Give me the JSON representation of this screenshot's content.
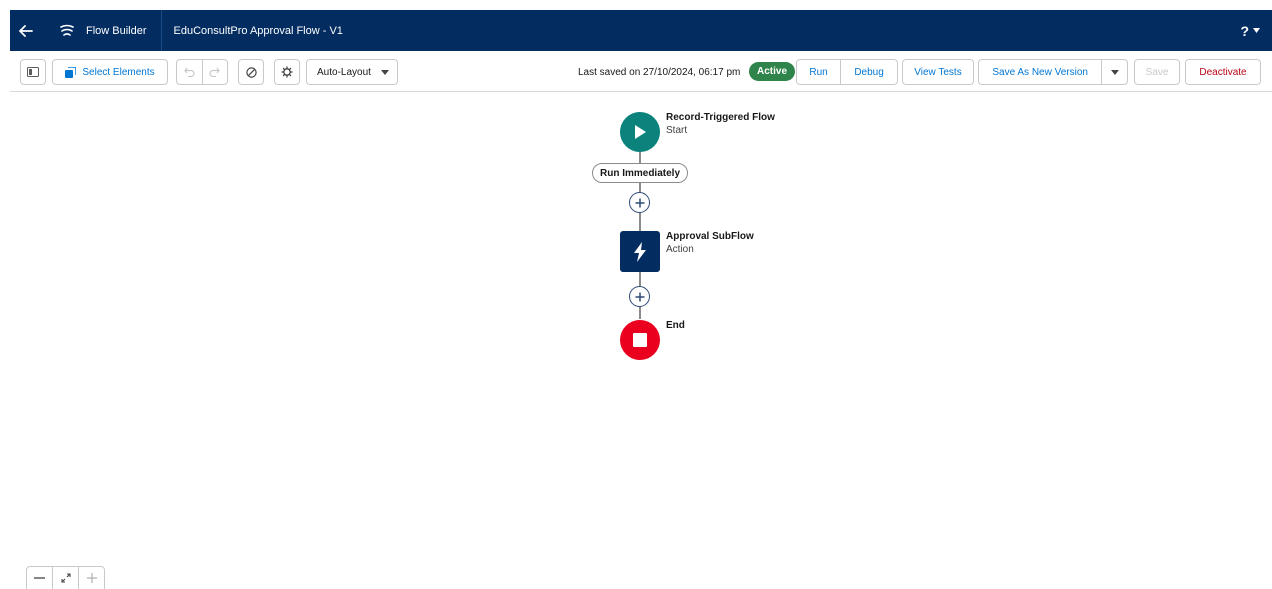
{
  "header": {
    "app_name": "Flow Builder",
    "flow_name": "EduConsultPro Approval Flow - V1",
    "help_label": "?"
  },
  "toolbar": {
    "select_elements_label": "Select Elements",
    "layout_label": "Auto-Layout",
    "last_saved": "Last saved on 27/10/2024, 06:17 pm",
    "status_badge": "Active",
    "run_label": "Run",
    "debug_label": "Debug",
    "view_tests_label": "View Tests",
    "save_as_new_version_label": "Save As New Version",
    "save_label": "Save",
    "deactivate_label": "Deactivate"
  },
  "canvas": {
    "start": {
      "title": "Record-Triggered Flow",
      "subtitle": "Start"
    },
    "path_label": "Run Immediately",
    "action": {
      "title": "Approval SubFlow",
      "subtitle": "Action"
    },
    "end": {
      "title": "End"
    }
  },
  "icons": {
    "back": "arrow-left-icon",
    "logo": "flow-icon",
    "panel": "panel-toggle-icon",
    "select": "select-elements-icon",
    "undo": "undo-icon",
    "redo": "redo-icon",
    "validate": "ban-icon",
    "settings": "gear-icon",
    "start": "play-icon",
    "action": "lightning-icon",
    "end": "stop-icon",
    "add": "plus-icon",
    "zoom_out": "minus-icon",
    "fit": "fit-to-view-icon",
    "zoom_in": "plus-icon"
  },
  "colors": {
    "header_bg": "#032d60",
    "brand_blue": "#0176d3",
    "active_green": "#2e844a",
    "start_teal": "#0b827c",
    "action_navy": "#032d60",
    "end_red": "#ea001e",
    "deactivate_red": "#ba0517"
  }
}
